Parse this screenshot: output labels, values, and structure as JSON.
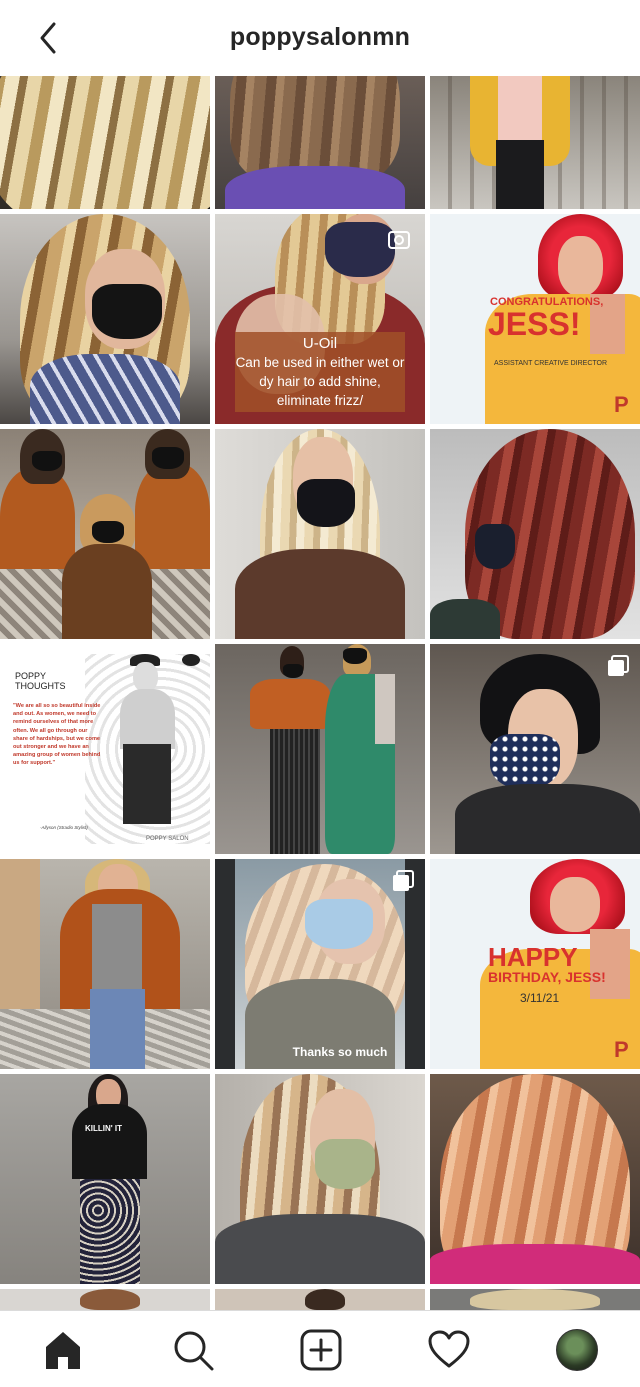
{
  "header": {
    "title": "poppysalonmn",
    "back_icon": "chevron-left-icon"
  },
  "posts": [
    {
      "alt": "curly blonde balayage",
      "type": "photo"
    },
    {
      "alt": "brunette curly bob",
      "type": "photo"
    },
    {
      "alt": "yellow cardigan outfit",
      "type": "photo"
    },
    {
      "alt": "blonde balayage with mask",
      "type": "photo"
    },
    {
      "alt": "U-Oil video",
      "type": "video",
      "caption_title": "U-Oil",
      "caption_text": "Can be used in either wet or dy hair to add shine, eliminate frizz/"
    },
    {
      "alt": "congratulations jess",
      "type": "photo",
      "headline_1": "CONGRATULATIONS,",
      "headline_2": "JESS!",
      "subtitle": "ASSISTANT CREATIVE DIRECTOR",
      "brand_mark": "P"
    },
    {
      "alt": "three stylists in sweaters",
      "type": "photo"
    },
    {
      "alt": "long straight blonde",
      "type": "photo"
    },
    {
      "alt": "red copper waves",
      "type": "photo"
    },
    {
      "alt": "poppy thoughts quote",
      "type": "photo",
      "heading_1": "POPPY",
      "heading_2": "THOUGHTS",
      "quote": "\"We are all so so beautiful inside and out. As women, we need to remind ourselves of that more often. We all go through our share of hardships, but we come out stronger and we have an amazing group of women behind us for support.\"",
      "signature": "-Allyson (Stradio Stylist)",
      "footer": "POPPY SALON"
    },
    {
      "alt": "two stylists posing",
      "type": "photo"
    },
    {
      "alt": "pixie cut with star mask",
      "type": "carousel"
    },
    {
      "alt": "orange cardigan outfit",
      "type": "photo"
    },
    {
      "alt": "mirror selfie thanks",
      "type": "carousel",
      "caption_text": "Thanks so much"
    },
    {
      "alt": "happy birthday jess",
      "type": "photo",
      "headline_1": "HAPPY",
      "headline_2": "BIRTHDAY, JESS!",
      "date": "3/11/21",
      "brand_mark": "P"
    },
    {
      "alt": "killin it tee outfit",
      "type": "photo",
      "shirt_text": "KILLIN' IT"
    },
    {
      "alt": "dimensional blonde lob",
      "type": "photo"
    },
    {
      "alt": "strawberry copper waves",
      "type": "photo"
    }
  ],
  "nav": [
    {
      "name": "home-icon"
    },
    {
      "name": "search-icon"
    },
    {
      "name": "new-post-icon"
    },
    {
      "name": "activity-heart-icon"
    },
    {
      "name": "profile-avatar"
    }
  ],
  "colors": {
    "text": "#262626",
    "divider": "#dbdbdb",
    "accent_red": "#d8322e",
    "poppy_red": "#c0392b"
  }
}
